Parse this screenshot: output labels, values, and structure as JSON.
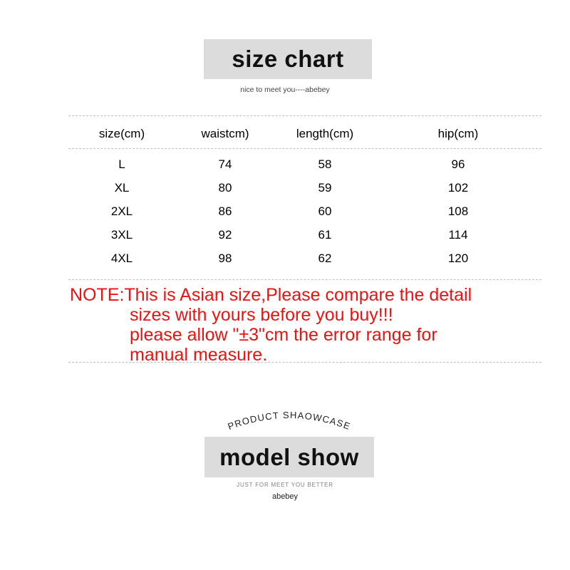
{
  "size_chart": {
    "banner_title": "size chart",
    "subtitle": "nice to meet you----abebey",
    "table": {
      "headers": [
        "size(cm)",
        "waistcm)",
        "length(cm)",
        "hip(cm)"
      ],
      "rows": [
        [
          "L",
          "74",
          "58",
          "96"
        ],
        [
          "XL",
          "80",
          "59",
          "102"
        ],
        [
          "2XL",
          "86",
          "60",
          "108"
        ],
        [
          "3XL",
          "92",
          "61",
          "114"
        ],
        [
          "4XL",
          "98",
          "62",
          "120"
        ]
      ]
    },
    "note": {
      "line_1": "NOTE:This is Asian size,Please compare the detail",
      "line_2": "sizes with yours before you buy!!!",
      "line_3": "please allow \"±3\"cm the error range for",
      "line_4": "manual measure.",
      "color": "#ee1111"
    }
  },
  "model_show": {
    "arc_text": "PRODUCT  SHAOWCASE",
    "banner_title": "model show",
    "subtitle": "JUST FOR MEET YOU BETTER",
    "brand": "abebey"
  },
  "theme": {
    "banner_bg": "#dcdcdc",
    "divider_color": "#bfbfbf",
    "text_color": "#000000"
  }
}
